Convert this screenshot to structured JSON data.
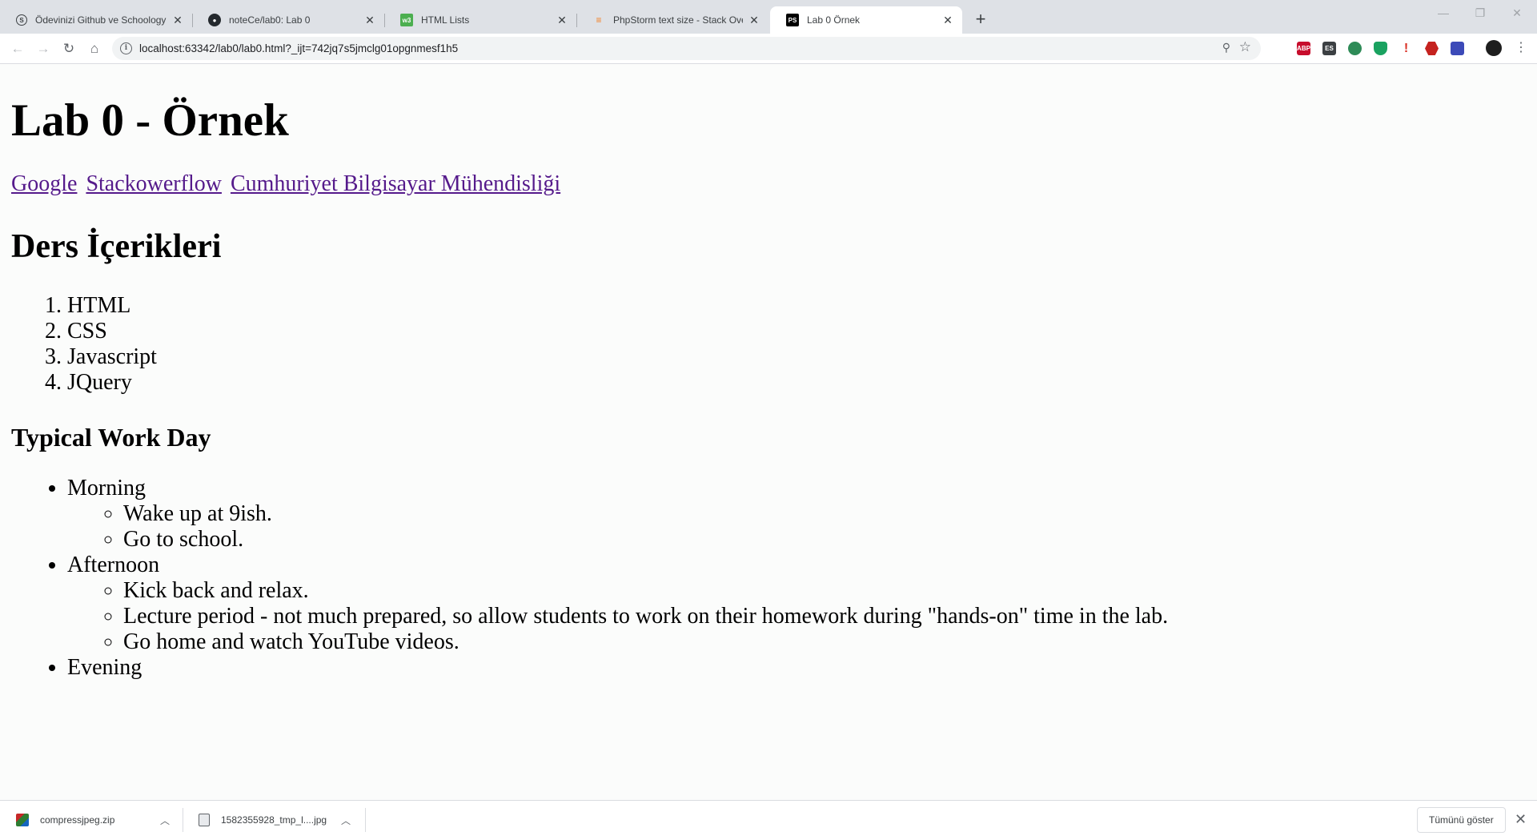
{
  "browser": {
    "tabs": [
      {
        "title": "Ödevinizi Github ve Schoology Ü",
        "favicon": "schoology-icon",
        "active": false
      },
      {
        "title": "noteCe/lab0: Lab 0",
        "favicon": "github-icon",
        "active": false
      },
      {
        "title": "HTML Lists",
        "favicon": "w3schools-icon",
        "active": false
      },
      {
        "title": "PhpStorm text size - Stack Overfl",
        "favicon": "stackoverflow-icon",
        "active": false
      },
      {
        "title": "Lab 0 Örnek",
        "favicon": "phpstorm-icon",
        "active": true
      }
    ],
    "url": "localhost:63342/lab0/lab0.html?_ijt=742jq7s5jmclg01opgnmesf1h5",
    "extensions": [
      {
        "name": "adblock-plus-icon",
        "label": "ABP",
        "color": "#c70d2c"
      },
      {
        "name": "extension-es-icon",
        "label": "ES",
        "color": "#3c4043"
      },
      {
        "name": "extension-globe-icon",
        "label": "",
        "color": "#2e8b57"
      },
      {
        "name": "extension-shield-icon",
        "label": "",
        "color": "#1aa260"
      },
      {
        "name": "extension-pin-icon",
        "label": "",
        "color": "#d93025"
      },
      {
        "name": "extension-hexagon-icon",
        "label": "",
        "color": "#c5221f"
      },
      {
        "name": "extension-screen-icon",
        "label": "",
        "color": "#3c4ab8"
      }
    ]
  },
  "page": {
    "title": "Lab 0 - Örnek",
    "links": [
      "Google",
      "Stackowerflow",
      "Cumhuriyet Bilgisayar Mühendisliği"
    ],
    "courses_heading": "Ders İçerikleri",
    "courses": [
      "HTML",
      "CSS",
      "Javascript",
      "JQuery"
    ],
    "workday_heading": "Typical Work Day",
    "workday": {
      "morning": "Morning",
      "morning_items": [
        "Wake up at 9ish.",
        "Go to school."
      ],
      "afternoon": "Afternoon",
      "afternoon_items": [
        "Kick back and relax.",
        "Lecture period - not much prepared, so allow students to work on their homework during \"hands-on\" time in the lab.",
        "Go home and watch YouTube videos."
      ],
      "evening": "Evening"
    }
  },
  "downloads": {
    "items": [
      {
        "filename": "compressjpeg.zip",
        "icon": "zip-archive-icon"
      },
      {
        "filename": "1582355928_tmp_l....jpg",
        "icon": "image-file-icon"
      }
    ],
    "show_all_label": "Tümünü göster"
  },
  "colors": {
    "link_visited": "#551a8b",
    "tabstrip_bg": "#dee1e6"
  }
}
